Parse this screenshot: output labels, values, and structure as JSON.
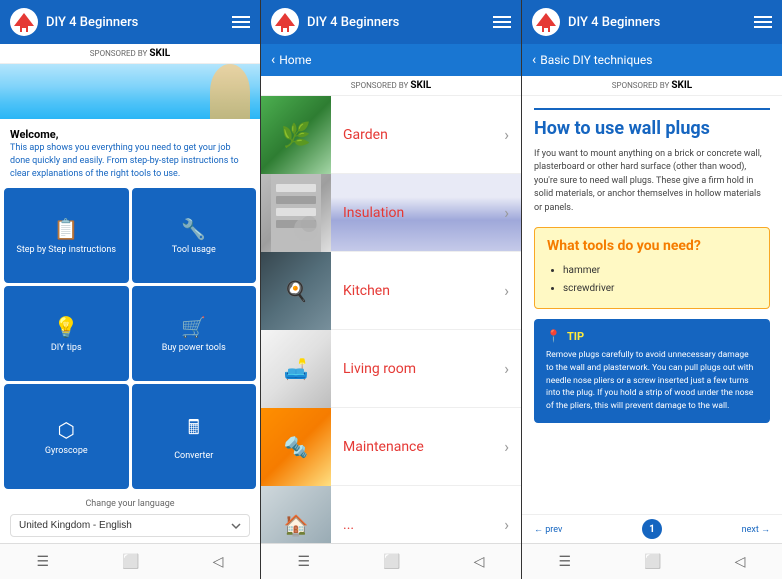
{
  "app": {
    "name": "DIY 4 Beginners",
    "logo_alt": "house-logo"
  },
  "screen1": {
    "header": {
      "title": "DIY 4 Beginners"
    },
    "sponsored": "SPONSORED BY",
    "skil": "SKIL",
    "welcome_title": "Welcome,",
    "welcome_desc": "This app shows you everything you need to get your job done quickly and easily. From step-by-step instructions to clear explanations of the right tools to use.",
    "buttons": [
      {
        "id": "step-by-step",
        "label": "Step by Step instructions",
        "icon": "📋"
      },
      {
        "id": "tool-usage",
        "label": "Tool usage",
        "icon": "🔧"
      },
      {
        "id": "diy-tips",
        "label": "DIY tips",
        "icon": "💡"
      },
      {
        "id": "buy-tools",
        "label": "Buy power tools",
        "icon": "🛒"
      },
      {
        "id": "gyroscope",
        "label": "Gyroscope",
        "icon": "⬡"
      },
      {
        "id": "converter",
        "label": "Converter",
        "icon": "🖩"
      }
    ],
    "language_label": "Change your language",
    "language_value": "United Kingdom - English"
  },
  "screen2": {
    "header": {
      "title": "DIY 4 Beginners"
    },
    "back_label": "Home",
    "sponsored": "SPONSORED BY",
    "skil": "SKIL",
    "categories": [
      {
        "id": "garden",
        "name": "Garden",
        "thumb_type": "garden",
        "thumb_emoji": "🌿"
      },
      {
        "id": "insulation",
        "name": "Insulation",
        "thumb_type": "insulation",
        "thumb_emoji": "🏠"
      },
      {
        "id": "kitchen",
        "name": "Kitchen",
        "thumb_type": "kitchen",
        "thumb_emoji": "🍳"
      },
      {
        "id": "living-room",
        "name": "Living room",
        "thumb_type": "livingroom",
        "thumb_emoji": "🛋️"
      },
      {
        "id": "maintenance",
        "name": "Maintenance",
        "thumb_type": "maintenance",
        "thumb_emoji": "🔩"
      },
      {
        "id": "more",
        "name": "...",
        "thumb_type": "more",
        "thumb_emoji": "🏠"
      }
    ],
    "chevron": "›"
  },
  "screen3": {
    "header": {
      "title": "DIY 4 Beginners"
    },
    "back_label": "Basic DIY techniques",
    "sponsored": "SPONSORED BY",
    "skil": "SKIL",
    "article": {
      "title": "How to use wall plugs",
      "body": "If you want to mount anything on a brick or concrete wall, plasterboard or other hard surface (other than wood), you're sure to need wall plugs. These give a firm hold in solid materials, or anchor themselves in hollow materials or panels.",
      "tools_title": "What tools do you need?",
      "tools": [
        "hammer",
        "screwdriver"
      ],
      "tip_label": "TIP",
      "tip_text": "Remove plugs carefully to avoid unnecessary damage to the wall and plasterwork. You can pull plugs out with needle nose pliers or a screw inserted just a few turns into the plug. If you hold a strip of wood under the nose of the pliers, this will prevent damage to the wall."
    },
    "nav": {
      "prev": "← prev",
      "next": "next →",
      "step": "1"
    }
  }
}
